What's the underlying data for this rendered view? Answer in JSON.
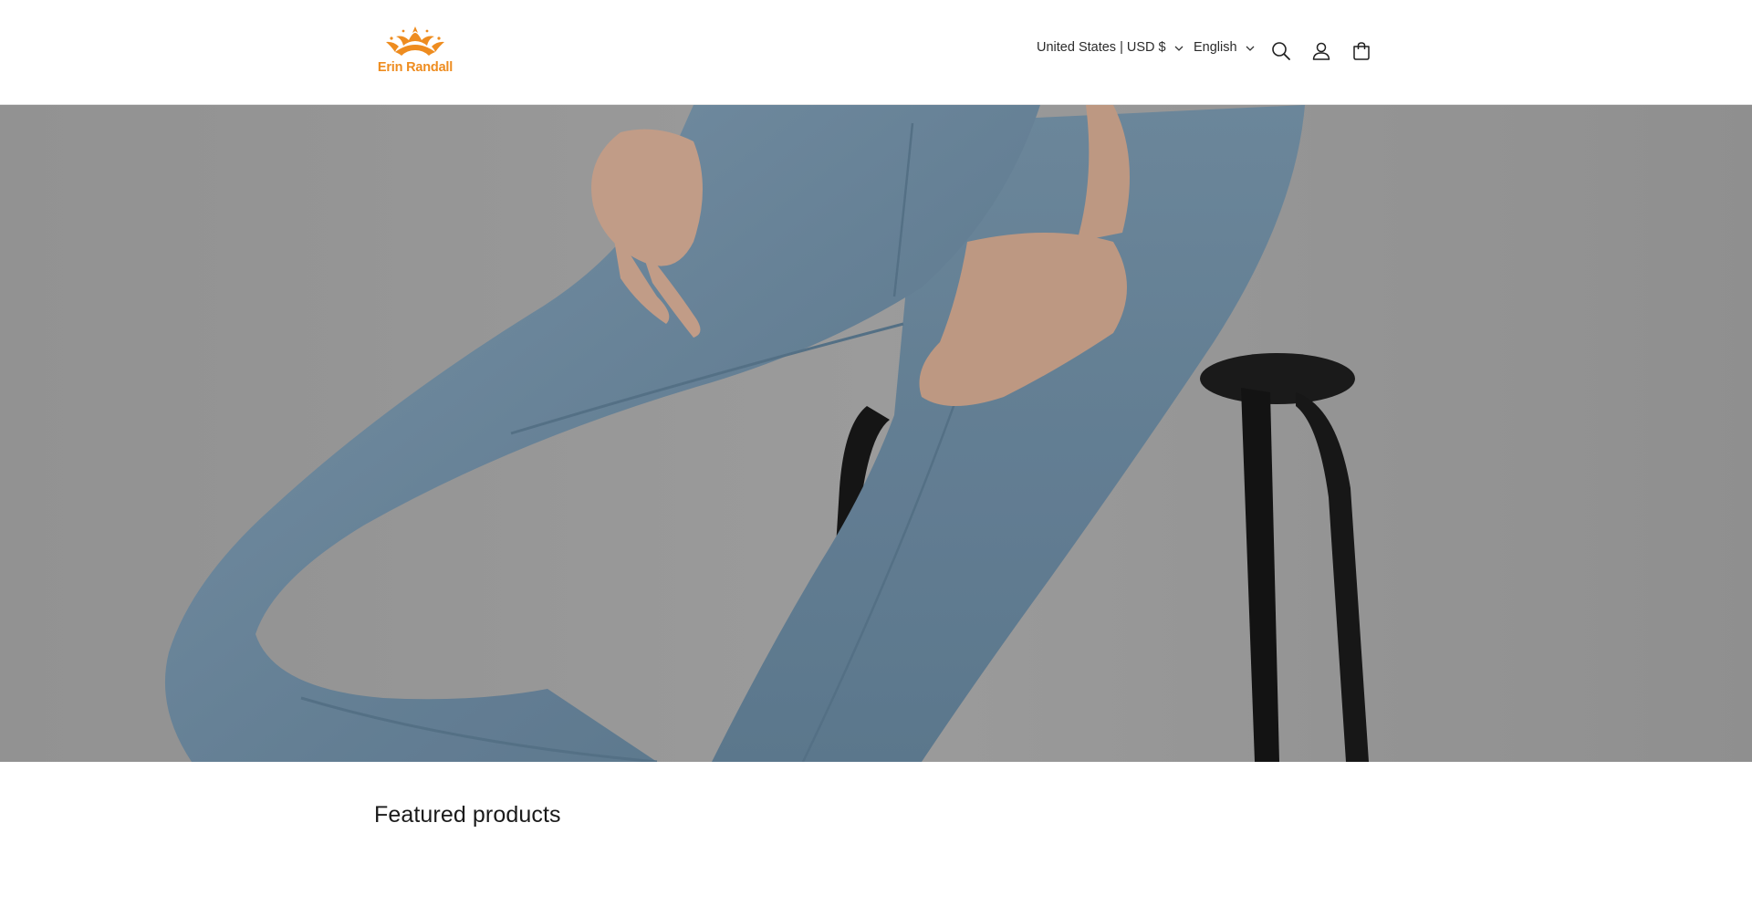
{
  "header": {
    "logo_text": "Erin Randall",
    "country_selector": "United States | USD $",
    "language_selector": "English",
    "icons": {
      "search": "search-icon",
      "account": "account-icon",
      "cart": "cart-icon"
    },
    "brand_color": "#ee8c1f"
  },
  "hero": {
    "image": "model-in-light-blue-jeans-on-black-stool"
  },
  "featured": {
    "title": "Featured products"
  }
}
